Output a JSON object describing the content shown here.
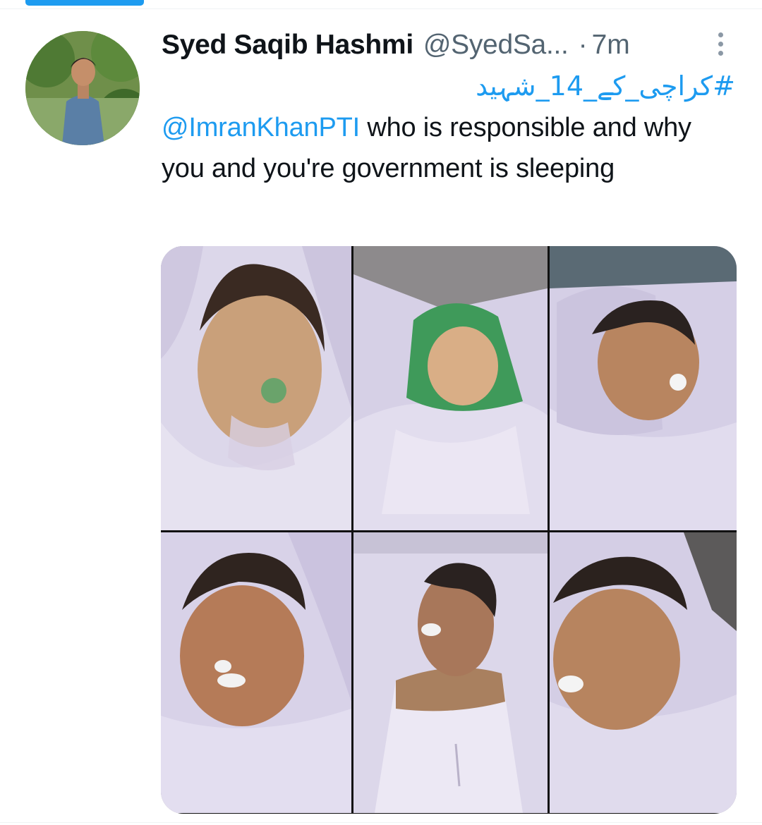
{
  "colors": {
    "accent": "#1d9bf0",
    "text_primary": "#0f1419",
    "text_secondary": "#536471"
  },
  "tweet": {
    "author": {
      "display_name": "Syed Saqib Hashmi",
      "handle": "@SyedSa...",
      "avatar_icon": "profile-photo"
    },
    "separator": "·",
    "timestamp": "7m",
    "more_icon": "more-vertical-icon",
    "hashtag": "#کراچی_کے_14_شہید",
    "mention": "@ImranKhanPTI",
    "body": " who is responsible and why you and you're government is sleeping",
    "media": {
      "count": 6,
      "layout": "grid-3x2"
    }
  }
}
